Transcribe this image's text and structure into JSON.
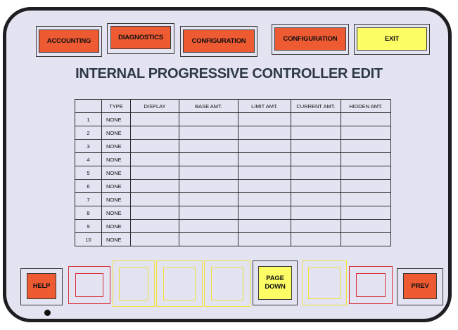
{
  "top_buttons": [
    {
      "label": "ACCOUNTING",
      "color": "#ee5a32"
    },
    {
      "label": "DIAGNOSTICS",
      "color": "#ee5a32"
    },
    {
      "label": "CONFIGURATION",
      "color": "#ee5a32"
    },
    {
      "label": "CONFIGURATION",
      "color": "#ee5a32"
    },
    {
      "label": "EXIT",
      "color": "#fdfd66"
    }
  ],
  "title": "INTERNAL PROGRESSIVE CONTROLLER EDIT",
  "table": {
    "headers": [
      "",
      "TYPE",
      "DISPLAY",
      "BASE AMT.",
      "LIMIT AMT.",
      "CURRENT AMT.",
      "HIDDEN AMT."
    ],
    "rows": [
      {
        "num": "1",
        "type": "NONE"
      },
      {
        "num": "2",
        "type": "NONE"
      },
      {
        "num": "3",
        "type": "NONE"
      },
      {
        "num": "4",
        "type": "NONE"
      },
      {
        "num": "5",
        "type": "NONE"
      },
      {
        "num": "6",
        "type": "NONE"
      },
      {
        "num": "7",
        "type": "NONE"
      },
      {
        "num": "8",
        "type": "NONE"
      },
      {
        "num": "9",
        "type": "NONE"
      },
      {
        "num": "10",
        "type": "NONE"
      }
    ]
  },
  "bottom": {
    "help_label": "HELP",
    "page_down_label": "PAGE DOWN",
    "prev_label": "PREV"
  },
  "colors": {
    "screen_bg": "#e3e3f1",
    "button_red": "#ee5a32",
    "button_yellow": "#fdfd66",
    "border_dark": "#1e1e22"
  }
}
